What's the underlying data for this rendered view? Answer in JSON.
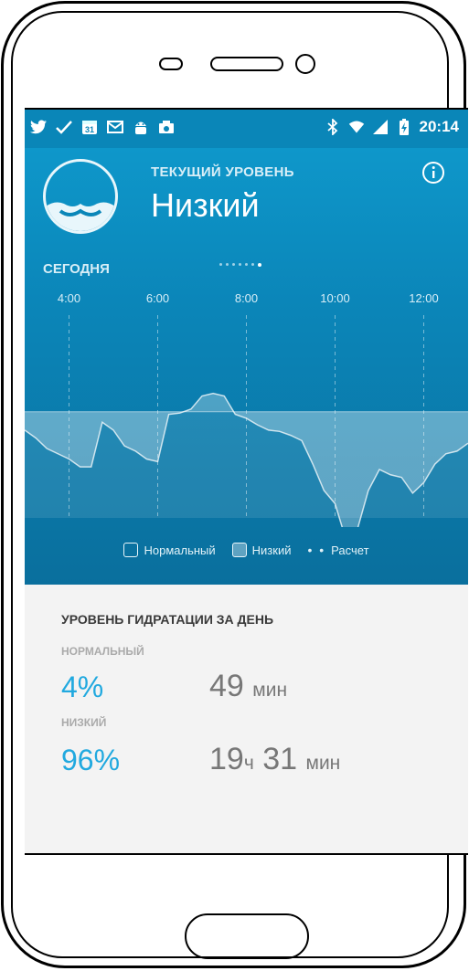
{
  "status_bar": {
    "left_icons": [
      "twitter-icon",
      "check-icon",
      "calendar-icon",
      "gmail-icon",
      "android-icon",
      "photo-icon"
    ],
    "calendar_day": "31",
    "right_icons": [
      "bluetooth-icon",
      "wifi-icon",
      "signal-icon",
      "battery-icon"
    ],
    "time": "20:14"
  },
  "header": {
    "level_label": "ТЕКУЩИЙ УРОВЕНЬ",
    "level_value": "Низкий",
    "info_icon": "info-icon"
  },
  "today_label": "СЕГОДНЯ",
  "pager": {
    "total": 7,
    "active_index": 6
  },
  "chart_data": {
    "type": "area",
    "x_ticks": [
      "4:00",
      "6:00",
      "8:00",
      "10:00",
      "12:00"
    ],
    "xlim": [
      "3:00",
      "13:00"
    ],
    "threshold": 1,
    "ylim": [
      0,
      2
    ],
    "grid": "vertical dashed lines at tick positions",
    "series": [
      {
        "x": [
          "3:00",
          "3:15",
          "3:30",
          "3:45",
          "4:00",
          "4:15",
          "4:30",
          "4:45",
          "5:00",
          "5:15",
          "5:30",
          "5:45",
          "6:00",
          "6:15",
          "6:30",
          "6:45",
          "7:00",
          "7:15",
          "7:30",
          "7:45",
          "8:00",
          "8:15",
          "8:30",
          "8:45",
          "9:00",
          "9:15",
          "9:30",
          "9:45",
          "10:00",
          "10:15",
          "10:30",
          "10:45",
          "11:00",
          "11:15",
          "11:30",
          "11:45",
          "12:00",
          "12:15",
          "12:30",
          "12:45",
          "13:00"
        ],
        "values": [
          0.86,
          0.8,
          0.72,
          0.68,
          0.64,
          0.58,
          0.58,
          0.92,
          0.86,
          0.74,
          0.7,
          0.64,
          0.62,
          0.98,
          0.99,
          1.02,
          1.12,
          1.14,
          1.12,
          0.98,
          0.95,
          0.9,
          0.86,
          0.85,
          0.82,
          0.78,
          0.6,
          0.4,
          0.3,
          0.02,
          0.1,
          0.4,
          0.56,
          0.52,
          0.5,
          0.38,
          0.46,
          0.6,
          0.68,
          0.7,
          0.76
        ]
      }
    ]
  },
  "legend": {
    "normal": "Нормальный",
    "low": "Низкий",
    "estimate": "Расчет",
    "dots": "• •"
  },
  "stats": {
    "title": "УРОВЕНЬ ГИДРАТАЦИИ ЗА ДЕНЬ",
    "normal": {
      "label": "НОРМАЛЬНЫЙ",
      "percent": "4%",
      "duration_minutes": "49",
      "unit_minutes": "мин"
    },
    "low": {
      "label": "НИЗКИЙ",
      "percent": "96%",
      "duration_hours": "19",
      "unit_hours": "ч",
      "duration_minutes": "31",
      "unit_minutes": "мин"
    }
  },
  "colors": {
    "header_blue": "#0b86b9",
    "accent_percent": "#21a9df",
    "stats_bg": "#f3f3f3"
  }
}
